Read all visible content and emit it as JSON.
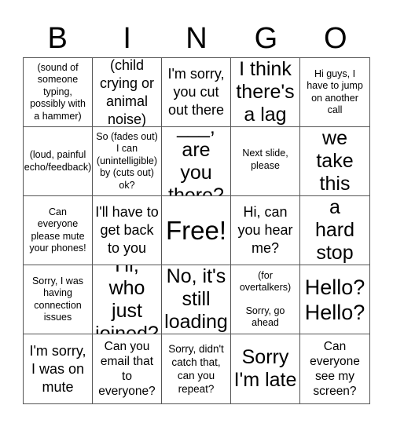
{
  "header": {
    "letters": [
      "B",
      "I",
      "N",
      "G",
      "O"
    ]
  },
  "board": {
    "cells": [
      [
        "(sound of\nsomeone\ntyping,\npossibly with\na hammer)",
        "(child\ncrying or\nanimal\nnoise)",
        "I'm sorry,\nyou cut\nout there",
        "I think\nthere's\na lag",
        "Hi guys, I\nhave to jump\non another\ncall"
      ],
      [
        "(loud, painful\necho/feedback)",
        "So (fades out)\nI can\n(unintelligible)\nby (cuts out)\nok?",
        "___, are\nyou\nthere?",
        "Next slide,\nplease",
        "Can we\ntake this\noffline?"
      ],
      [
        "Can\neveryone\nplease mute\nyour phones!",
        "I'll have to\nget back\nto you",
        "Free!",
        "Hi, can\nyou hear\nme?",
        "I have a\nhard\nstop at.."
      ],
      [
        "Sorry, I was\nhaving\nconnection\nissues",
        "Hi, who\njust\njoined?",
        "No, it's\nstill\nloading",
        "(for\novertalkers)",
        "Hello?\nHello?"
      ],
      [
        "I'm sorry,\nI was on\nmute",
        "Can you\nemail that\nto\neveryone?",
        "Sorry, didn't\ncatch that,\ncan you\nrepeat?",
        "Sorry\nI'm late",
        "Can\neveryone\nsee my\nscreen?"
      ]
    ],
    "sub_texts": {
      "3-3": "Sorry, go\nahead"
    }
  }
}
